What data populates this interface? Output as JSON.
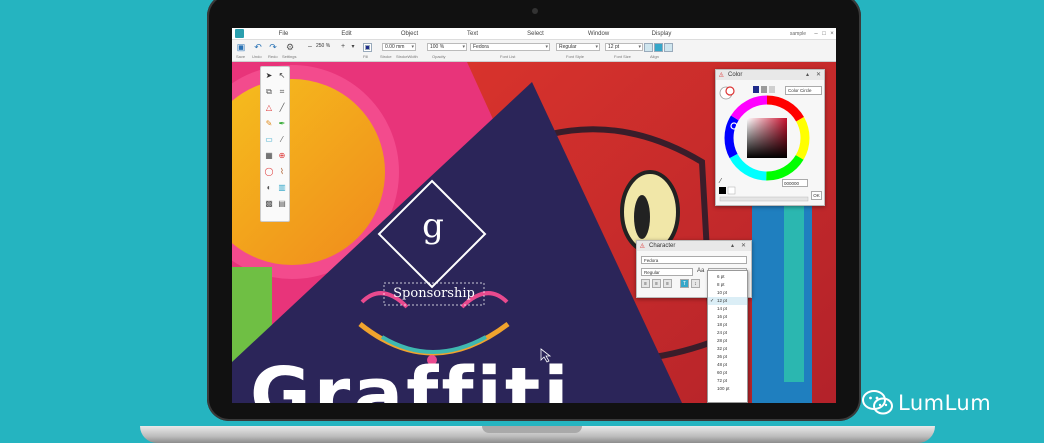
{
  "app": {
    "menu": [
      "File",
      "Edit",
      "Object",
      "Text",
      "Select",
      "Window",
      "Display"
    ],
    "user": "sample",
    "window_controls": [
      "–",
      "□",
      "×"
    ]
  },
  "toolbar": {
    "captions": [
      "Save",
      "Undo",
      "Redo",
      "Settings",
      "Fill",
      "Stroke",
      "StrokeWidth",
      "Opacity",
      "Font List",
      "Font Style",
      "Font Size",
      "Align"
    ],
    "zoom": "250 %",
    "stroke_width": "0.00 mm",
    "opacity": "100 %",
    "font": "Fedora",
    "font_style": "Regular",
    "font_size": "12 pt"
  },
  "color_panel": {
    "title": "Color",
    "mode": "Color Circle",
    "hex": "000000",
    "ok_label": "OK",
    "hue_color": "#c8102e"
  },
  "character_panel": {
    "title": "Character",
    "font": "Fedora",
    "style": "Regular",
    "size": "12 pt",
    "size_options": [
      "6 pt",
      "8 pt",
      "10 pt",
      "12 pt",
      "14 pt",
      "16 pt",
      "18 pt",
      "24 pt",
      "28 pt",
      "32 pt",
      "36 pt",
      "48 pt",
      "60 pt",
      "72 pt",
      "100 pt"
    ],
    "selected_size": "12 pt"
  },
  "artwork": {
    "logo_letter": "g",
    "sponsor_text": "Sponsorship",
    "headline": "Graffiti"
  },
  "watermark": {
    "text": "LumLum",
    "icon": "wechat-icon"
  },
  "colors": {
    "background": "#25b4c0",
    "accent": "#35a7c9",
    "navy": "#2b2559"
  }
}
